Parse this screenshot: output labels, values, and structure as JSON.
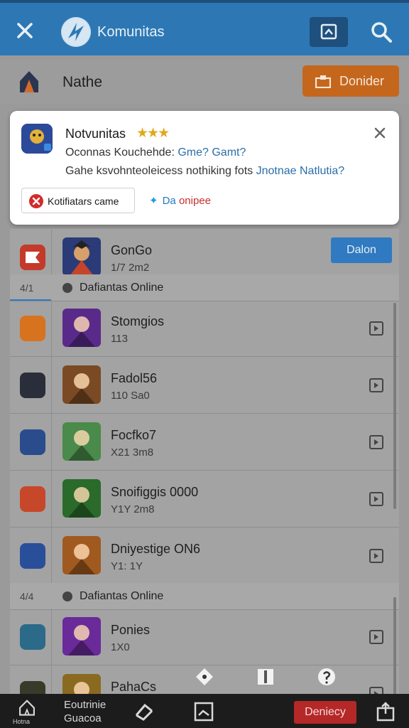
{
  "header": {
    "title": "Komunitas",
    "close_icon": "close-icon",
    "logo_icon": "app-logo",
    "bookmark_icon": "bookmark-icon",
    "search_icon": "search-icon"
  },
  "subheader": {
    "name": "Nathe",
    "donate_label": "Donider",
    "house_icon": "house-icon"
  },
  "notification": {
    "title": "Notvunitas",
    "stars": "★★★",
    "line1_plain": "Oconnas Kouchehde: ",
    "line1_highlight": "Gme? Gamt?",
    "line2_plain": "Gahe ksvohnteoleicess nothiking fots ",
    "line2_highlight": "Jnotnae Natlutia?",
    "chip_label": "Kotifiatars came",
    "link_a": "Da",
    "link_b": "onipee"
  },
  "top_item": {
    "title": "GonGo",
    "subtitle": "1/7 2m2",
    "button_label": "Dalon",
    "icon_color": "#c43a2a",
    "thumb_color": "#2b3b78"
  },
  "sections": [
    {
      "count": "4/1",
      "label": "Dafiantas Online",
      "items": [
        {
          "title": "Stomgios",
          "subtitle": "113",
          "icon_color": "#d7721f",
          "thumb_color": "#5a2a8a"
        },
        {
          "title": "Fadol56",
          "subtitle": "110 Sa0",
          "icon_color": "#2a2e3a",
          "thumb_color": "#7a4a24"
        },
        {
          "title": "Focfko7",
          "subtitle": "X21 3m8",
          "icon_color": "#2a4c8c",
          "thumb_color": "#4a8a4a"
        },
        {
          "title": "Snoifiggis 0000",
          "subtitle": "Y1Y 2m8",
          "icon_color": "#c7472a",
          "thumb_color": "#2a6a2a"
        },
        {
          "title": "Dniyestige ON6",
          "subtitle": "Y1: 1Y",
          "icon_color": "#2a4f9a",
          "thumb_color": "#a05a20"
        }
      ]
    },
    {
      "count": "4/4",
      "label": "Dafiantas Online",
      "items": [
        {
          "title": "Ponies",
          "subtitle": "1X0",
          "icon_color": "#2c6a8a",
          "thumb_color": "#6a2a9a"
        },
        {
          "title": "PahaCs",
          "subtitle": "",
          "icon_color": "#3a3a2a",
          "thumb_color": "#8a6a20"
        }
      ]
    }
  ],
  "floating_icons": [
    "pin-icon",
    "flag-icon",
    "help-icon"
  ],
  "bottom_nav": {
    "home_label": "Hotna",
    "stack_line1": "Eoutrinie",
    "stack_line2": "Guacoa",
    "deploy_label": "Deniecy",
    "icons": [
      "home-icon",
      "refresh-icon",
      "image-icon",
      "share-icon"
    ]
  }
}
